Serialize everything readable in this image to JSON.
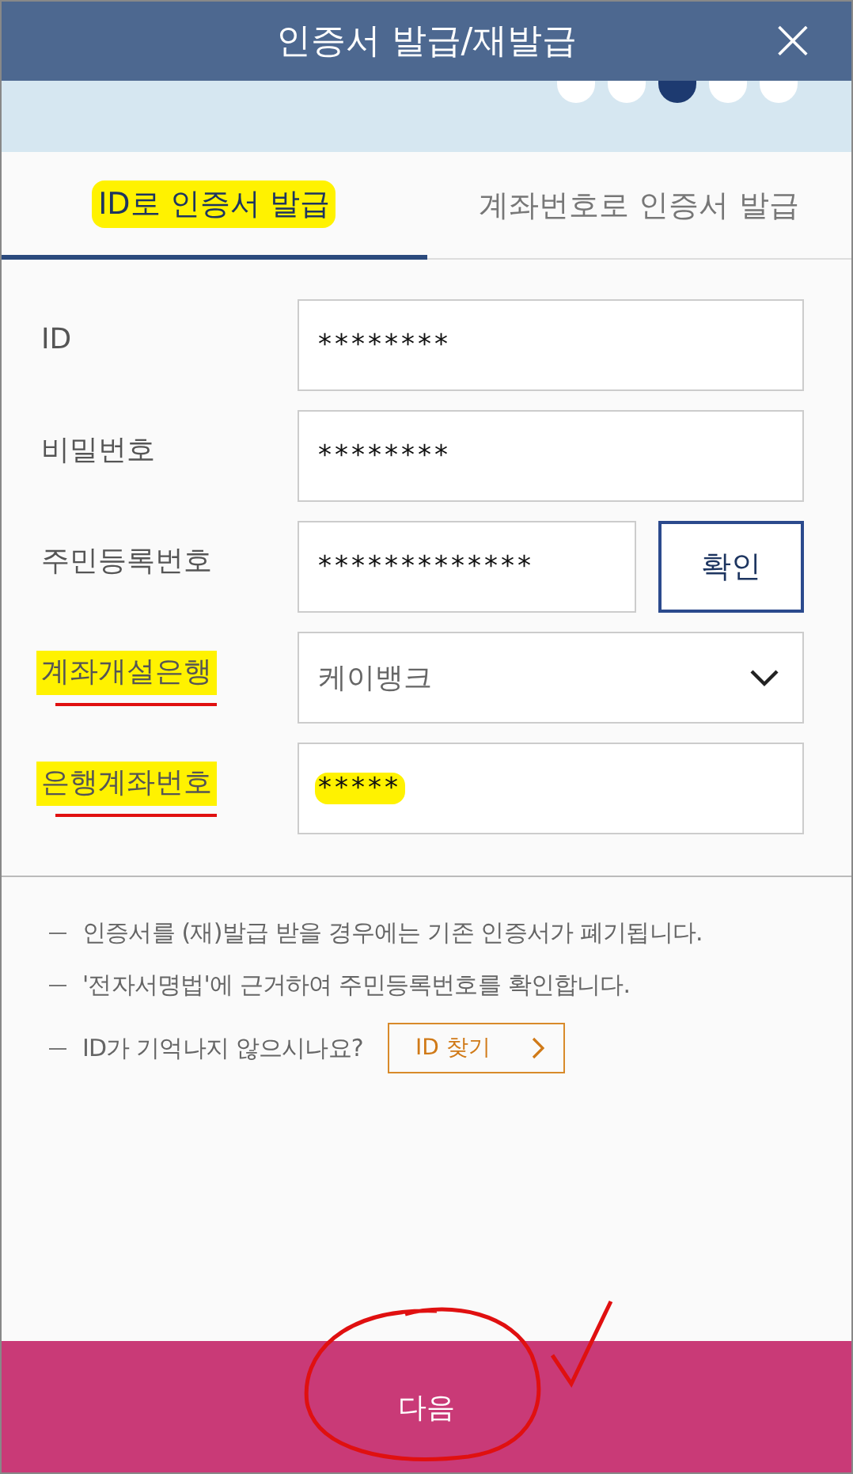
{
  "header": {
    "title": "인증서 발급/재발급",
    "close": "×"
  },
  "steps": [
    {
      "selected": false
    },
    {
      "selected": false
    },
    {
      "selected": true
    },
    {
      "selected": false
    },
    {
      "selected": false
    }
  ],
  "tabs": [
    {
      "label": "ID로 인증서 발급",
      "selected": true,
      "highlighted": true
    },
    {
      "label": "계좌번호로 인증서 발급",
      "selected": false,
      "highlighted": false
    }
  ],
  "fields": [
    {
      "kind": "input",
      "label": "ID",
      "value": "********",
      "highlighted": false,
      "underlined": false,
      "value_highlighted": false
    },
    {
      "kind": "input",
      "label": "비밀번호",
      "value": "********",
      "highlighted": false,
      "underlined": false,
      "value_highlighted": false
    },
    {
      "kind": "input_button",
      "label": "주민등록번호",
      "value": "*************",
      "button": "확인",
      "highlighted": false,
      "underlined": false,
      "value_highlighted": false
    },
    {
      "kind": "select",
      "label": "계좌개설은행",
      "value": "케이뱅크",
      "highlighted": true,
      "underlined": true,
      "value_highlighted": false
    },
    {
      "kind": "input",
      "label": "은행계좌번호",
      "value": "*****",
      "highlighted": true,
      "underlined": true,
      "value_highlighted": true
    }
  ],
  "notes": [
    {
      "text": "인증서를 (재)발급 받을 경우에는 기존 인증서가 폐기됩니다."
    },
    {
      "text": "'전자서명법'에 근거하여 주민등록번호를 확인합니다."
    },
    {
      "text": "ID가 기억나지 않으시나요?",
      "link": "ID 찾기"
    }
  ],
  "next_button": {
    "label": "다음",
    "circled": true
  }
}
